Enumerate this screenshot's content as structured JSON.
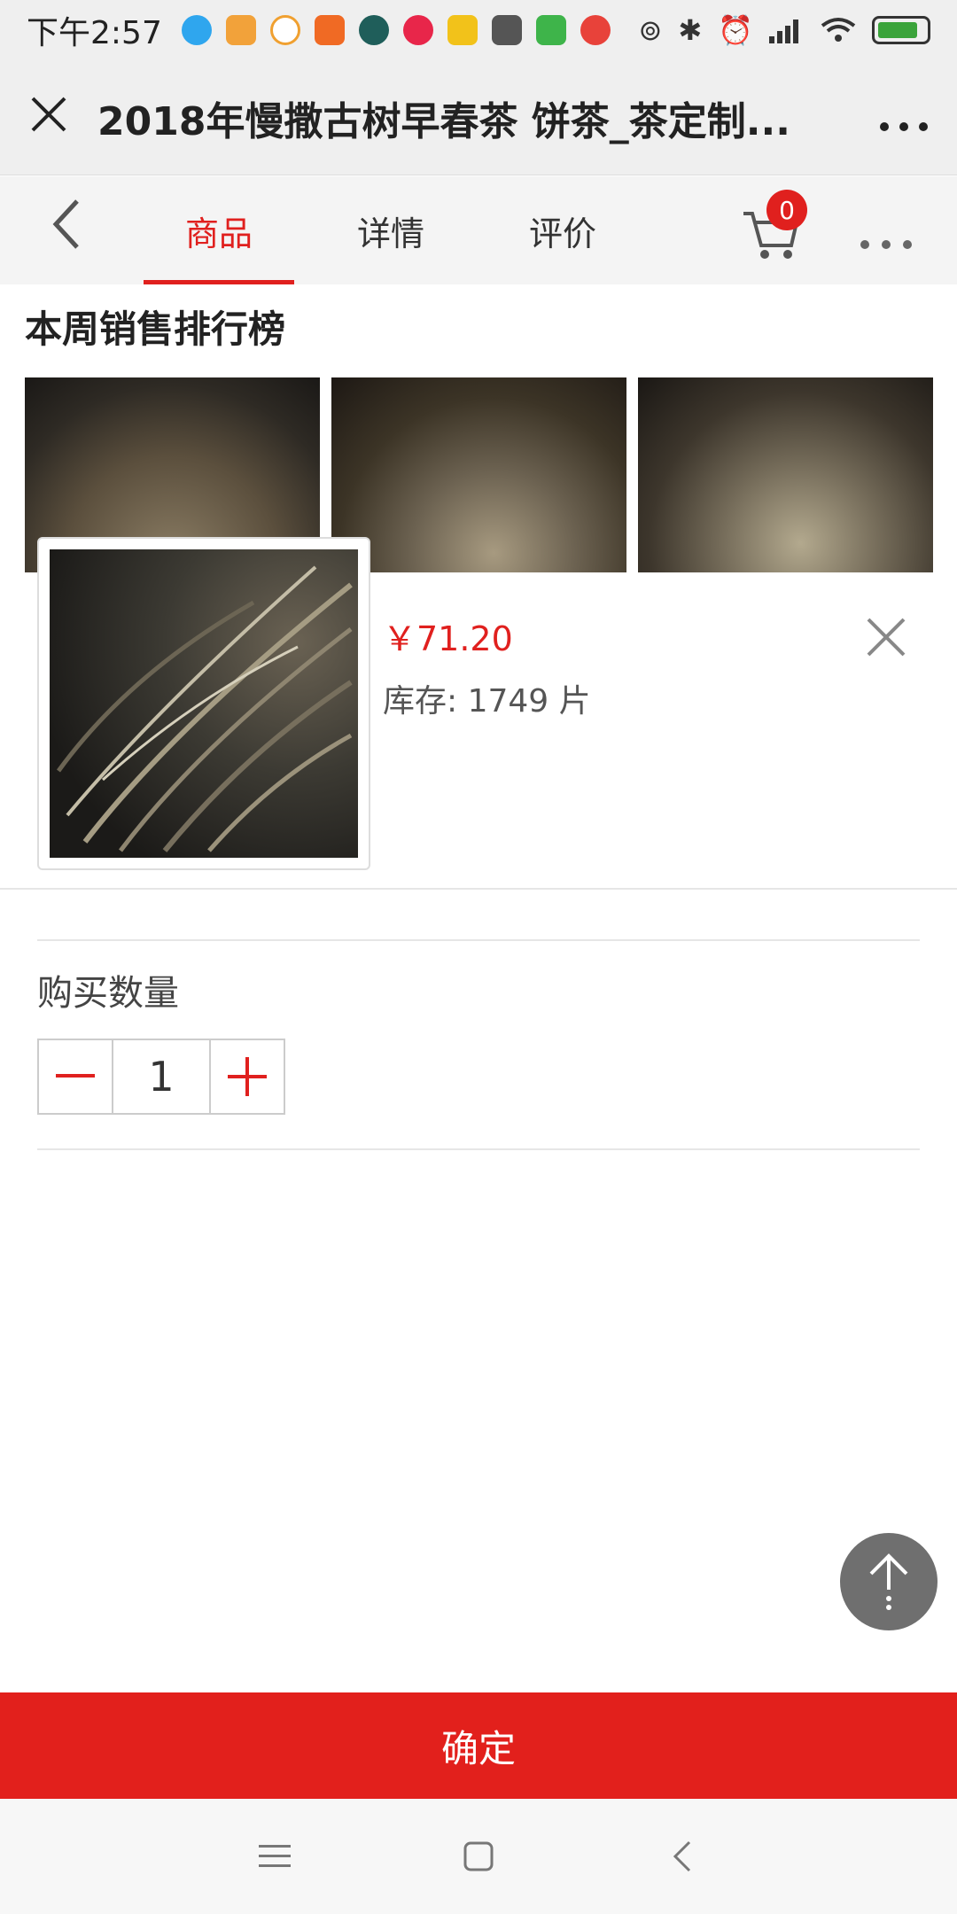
{
  "status_bar": {
    "time": "下午2:57"
  },
  "browser": {
    "title": "2018年慢撒古树早春茶 饼茶_茶定制...",
    "close_icon": "close-icon",
    "more_icon": "more-icon"
  },
  "tabs": {
    "items": [
      {
        "label": "商品",
        "active": true
      },
      {
        "label": "详情",
        "active": false
      },
      {
        "label": "评价",
        "active": false
      }
    ],
    "cart_count": "0",
    "accent_color": "#e0201e"
  },
  "rank": {
    "title": "本周销售排行榜"
  },
  "product": {
    "price": "￥71.20",
    "stock": "库存: 1749 片"
  },
  "quantity": {
    "label": "购买数量",
    "value": "1"
  },
  "confirm_label": "确定"
}
